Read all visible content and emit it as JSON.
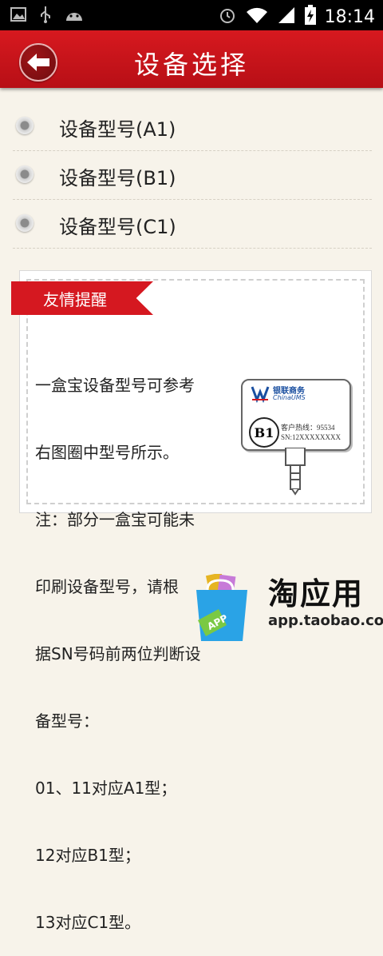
{
  "status_bar": {
    "time": "18:14",
    "icons_left": [
      "image-icon",
      "usb-icon",
      "android-icon"
    ],
    "icons_right": [
      "alarm-icon",
      "wifi-icon",
      "signal-icon",
      "battery-icon"
    ]
  },
  "header": {
    "title": "设备选择",
    "back_icon": "back-arrow-icon",
    "colors": {
      "header_bg": "#c8141b"
    }
  },
  "device_options": [
    {
      "label": "设备型号(A1)",
      "selected": false
    },
    {
      "label": "设备型号(B1)",
      "selected": false
    },
    {
      "label": "设备型号(C1)",
      "selected": false
    }
  ],
  "tip": {
    "ribbon_label": "友情提醒",
    "lines": [
      "一盒宝设备型号可参考",
      "右图圈中型号所示。",
      "注：部分一盒宝可能未",
      "印刷设备型号，请根",
      "据SN号码前两位判断设",
      "备型号：",
      "01、11对应A1型；",
      "12对应B1型；",
      "13对应C1型。"
    ],
    "illustration": {
      "brand": "银联商务",
      "brand_en": "ChinaUMS",
      "model": "B1",
      "hotline": "客户热线：95534",
      "sn": "SN:12XXXXXXXX"
    }
  },
  "promo": {
    "title": "淘应用",
    "url": "app.taobao.com",
    "bag_badge": "APP"
  }
}
